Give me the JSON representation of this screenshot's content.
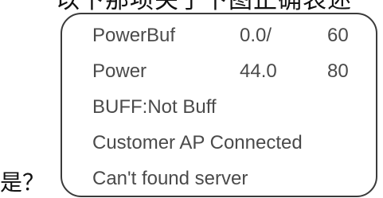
{
  "header_text": "以下那项关于下图正确表述",
  "side_text": "是？",
  "display": {
    "rows": [
      {
        "label": "PowerBuf",
        "value": "0.0/",
        "limit": "60"
      },
      {
        "label": "Power",
        "value": "44.0",
        "limit": "80"
      }
    ],
    "lines": [
      "BUFF:Not Buff",
      "Customer AP Connected",
      "Can't found server"
    ]
  }
}
